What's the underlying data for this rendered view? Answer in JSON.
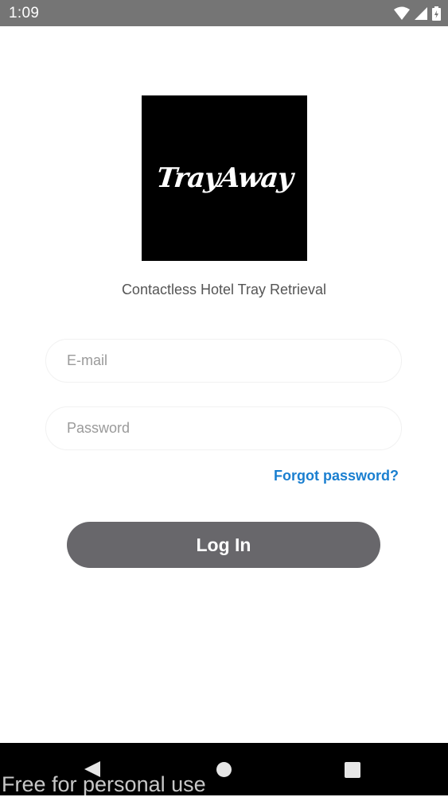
{
  "status_bar": {
    "time": "1:09",
    "icons": [
      "wifi-icon",
      "cellular-signal-icon",
      "battery-icon"
    ],
    "background_color": "#757575"
  },
  "logo": {
    "text": "TrayAway",
    "background_color": "#000000"
  },
  "tagline": "Contactless Hotel Tray Retrieval",
  "form": {
    "email_placeholder": "E-mail",
    "email_value": "",
    "password_placeholder": "Password",
    "password_value": "",
    "forgot_password_label": "Forgot password?",
    "login_label": "Log In",
    "link_color": "#1a7fd0",
    "button_color": "#68676b"
  },
  "nav_bar": {
    "buttons": [
      "back-icon",
      "home-icon",
      "recents-icon"
    ]
  },
  "watermark": "Free for personal use"
}
